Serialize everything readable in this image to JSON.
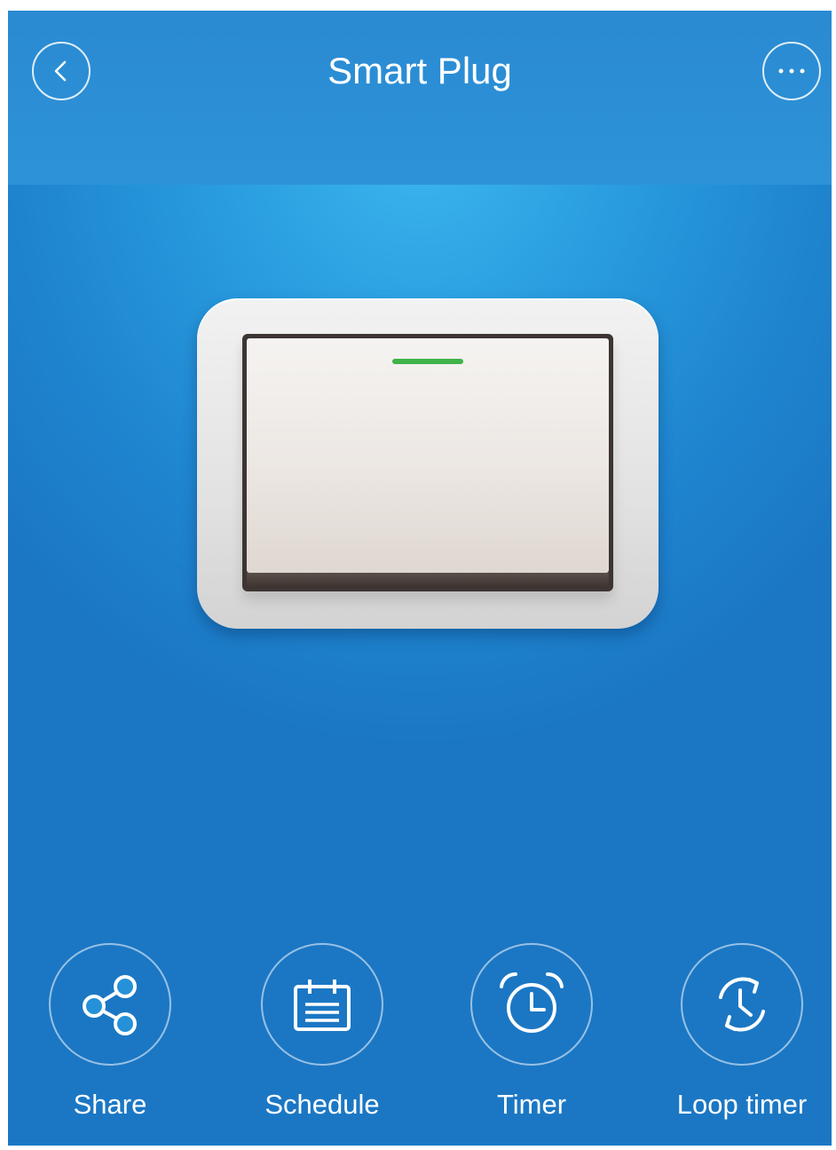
{
  "header": {
    "title": "Smart Plug",
    "back_icon": "chevron-left-icon",
    "more_icon": "more-dots-icon"
  },
  "switch": {
    "state": "on",
    "indicator_color": "#3fb34a"
  },
  "actions": [
    {
      "label": "Share",
      "icon": "share-icon"
    },
    {
      "label": "Schedule",
      "icon": "calendar-icon"
    },
    {
      "label": "Timer",
      "icon": "alarm-clock-icon"
    },
    {
      "label": "Loop timer",
      "icon": "loop-timer-icon"
    }
  ],
  "colors": {
    "background": "#2a9ee0",
    "header": "#2a8ad2",
    "text": "#ffffff"
  }
}
